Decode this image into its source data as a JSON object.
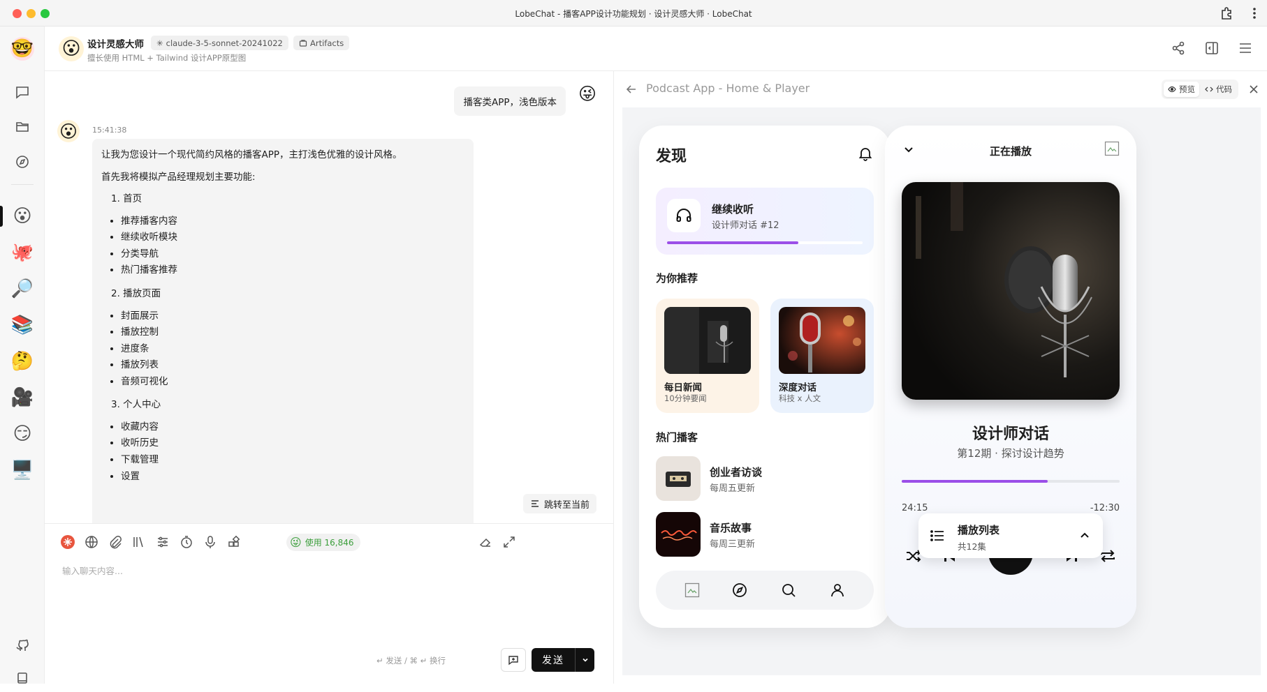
{
  "window": {
    "title": "LobeChat - 播客APP设计功能规划 · 设计灵感大师 · LobeChat"
  },
  "header": {
    "agent_name": "设计灵感大师",
    "agent_desc": "擅长使用 HTML + Tailwind 设计APP原型图",
    "model_tag": "claude-3-5-sonnet-20241022",
    "artifacts_tag": "Artifacts"
  },
  "chat": {
    "user_message": "播客类APP，浅色版本",
    "timestamp": "15:41:38",
    "ai_intro": "让我为您设计一个现代简约风格的播客APP，主打浅色优雅的设计风格。",
    "ai_plan": "首先我将模拟产品经理规划主要功能:",
    "sections": [
      {
        "title": "1. 首页",
        "items": [
          "推荐播客内容",
          "继续收听模块",
          "分类导航",
          "热门播客推荐"
        ]
      },
      {
        "title": "2. 播放页面",
        "items": [
          "封面展示",
          "播放控制",
          "进度条",
          "播放列表",
          "音频可视化"
        ]
      },
      {
        "title": "3. 个人中心",
        "items": [
          "收藏内容",
          "收听历史",
          "下载管理",
          "设置"
        ]
      }
    ],
    "jump_label": "跳转至当前"
  },
  "input": {
    "usage_label": "使用 16,846",
    "placeholder": "输入聊天内容...",
    "hint": "↵ 发送 / ⌘ ↵ 换行",
    "send_label": "发送"
  },
  "artifact": {
    "title": "Podcast App - Home & Player",
    "tab_preview": "预览",
    "tab_code": "代码"
  },
  "home": {
    "title": "发现",
    "continue": {
      "title": "继续收听",
      "subtitle": "设计师对话 #12",
      "progress": 0.67
    },
    "recommend_title": "为你推荐",
    "recommend": [
      {
        "title": "每日新闻",
        "subtitle": "10分钟要闻",
        "bg": "#fdf3e7"
      },
      {
        "title": "深度对话",
        "subtitle": "科技 x 人文",
        "bg": "#eaf2fd"
      }
    ],
    "hot_title": "热门播客",
    "hot": [
      {
        "title": "创业者访谈",
        "subtitle": "每周五更新"
      },
      {
        "title": "音乐故事",
        "subtitle": "每周三更新"
      }
    ]
  },
  "player": {
    "header": "正在播放",
    "title": "设计师对话",
    "subtitle": "第12期 · 探讨设计趋势",
    "elapsed": "24:15",
    "remaining": "-12:30",
    "progress": 0.67,
    "playlist_title": "播放列表",
    "playlist_count": "共12集"
  },
  "colors": {
    "accent": "#9b4fe8",
    "send": "#111111"
  }
}
